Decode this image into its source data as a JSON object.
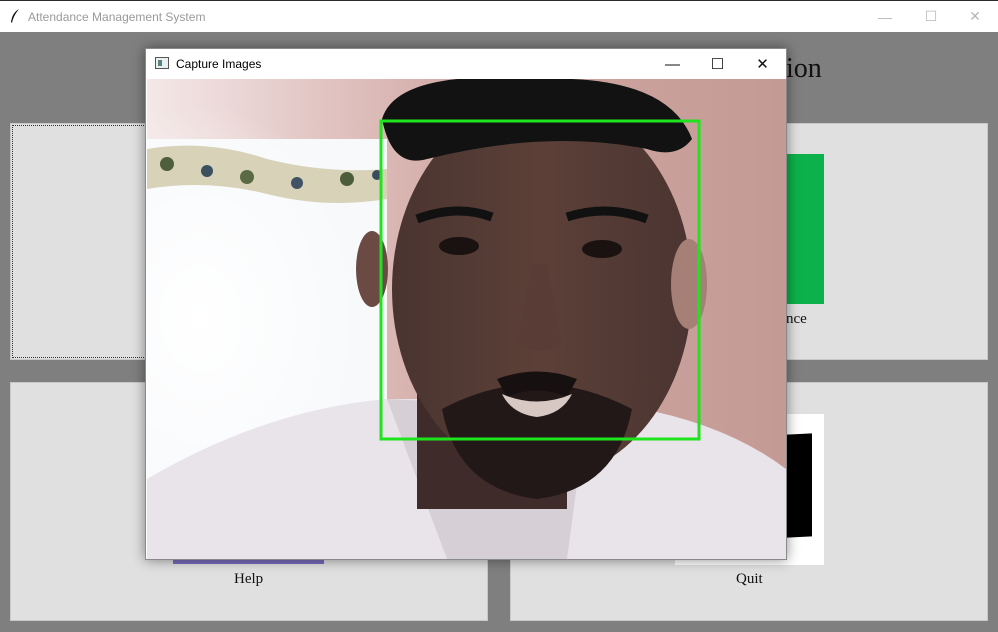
{
  "main_window": {
    "title": "Attendance Management System",
    "heading_fragment": "ion",
    "controls": {
      "minimize": "—",
      "maximize": "☐",
      "close": "✕"
    }
  },
  "panels": {
    "attendance_label": "nce",
    "help_label": "Help",
    "quit_label": "Quit"
  },
  "colors": {
    "attendance_tile": "#0db14b",
    "help_tile": "#7a6bbd",
    "face_box": "#1ee41e"
  },
  "capture_window": {
    "title": "Capture Images",
    "controls": {
      "minimize": "—",
      "maximize": "☐",
      "close": "✕"
    }
  }
}
